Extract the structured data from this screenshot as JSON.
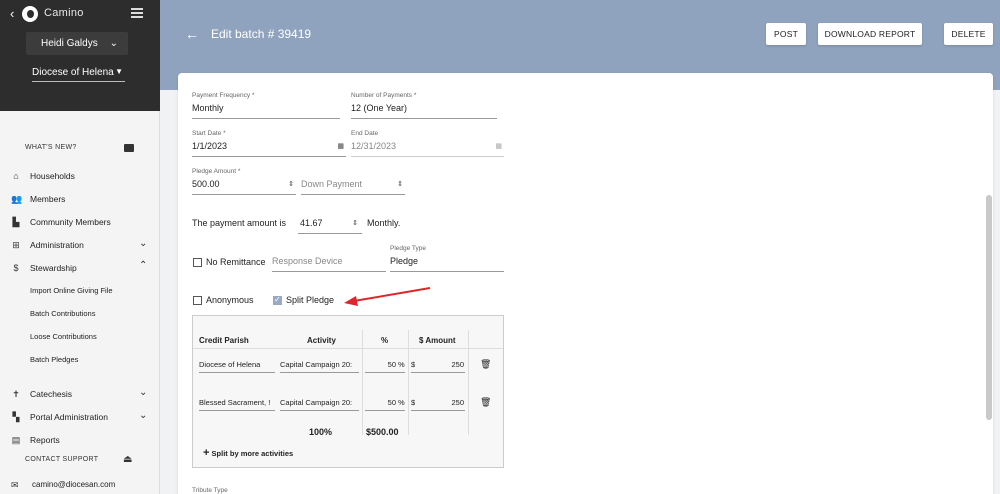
{
  "app": {
    "brand": "Camino",
    "user": "Heidi Galdys",
    "diocese": "Diocese of Helena"
  },
  "sidebar": {
    "whats_new": "WHAT'S NEW?",
    "items": [
      {
        "label": "Households",
        "icon": "home-icon"
      },
      {
        "label": "Members",
        "icon": "people-icon"
      },
      {
        "label": "Community Members",
        "icon": "community-icon"
      },
      {
        "label": "Administration",
        "icon": "grid-icon"
      },
      {
        "label": "Stewardship",
        "icon": "dollar-icon"
      },
      {
        "label": "Catechesis",
        "icon": "cross-icon"
      },
      {
        "label": "Portal Administration",
        "icon": "door-icon"
      },
      {
        "label": "Reports",
        "icon": "report-icon"
      }
    ],
    "stewardship_sub": [
      "Import Online Giving File",
      "Batch Contributions",
      "Loose Contributions",
      "Batch Pledges"
    ],
    "contact_support": "CONTACT SUPPORT",
    "email": "camino@diocesan.com"
  },
  "header": {
    "title": "Edit batch # 39419",
    "post": "POST",
    "download": "DOWNLOAD REPORT",
    "delete": "DELETE"
  },
  "form": {
    "payment_frequency": {
      "label": "Payment Frequency *",
      "value": "Monthly"
    },
    "number_of_payments": {
      "label": "Number of Payments *",
      "value": "12 (One Year)"
    },
    "start_date": {
      "label": "Start Date *",
      "value": "1/1/2023"
    },
    "end_date": {
      "label": "End Date",
      "value": "12/31/2023"
    },
    "pledge_amount": {
      "label": "Pledge Amount *",
      "value": "500.00"
    },
    "down_payment": {
      "placeholder": "Down Payment"
    },
    "payment_amount_prefix": "The payment amount is",
    "payment_amount": "41.67",
    "payment_amount_suffix": "Monthly.",
    "no_remittance": "No Remittance",
    "response_device": "Response Device",
    "pledge_type": {
      "label": "Pledge Type",
      "value": "Pledge"
    },
    "anonymous": "Anonymous",
    "split_pledge": "Split Pledge",
    "split_pledge_checked": true,
    "tribute_type": "Tribute Type"
  },
  "split_table": {
    "headers": {
      "parish": "Credit Parish",
      "activity": "Activity",
      "percent": "%",
      "amount": "$ Amount"
    },
    "rows": [
      {
        "parish": "Diocese of Helena",
        "activity": "Capital Campaign 20:",
        "percent": "50",
        "pct_sign": "%",
        "currency": "$",
        "amount": "250"
      },
      {
        "parish": "Blessed Sacrament, !",
        "activity": "Capital Campaign 20:",
        "percent": "50",
        "pct_sign": "%",
        "currency": "$",
        "amount": "250"
      }
    ],
    "total_percent": "100%",
    "total_amount": "$500.00",
    "add_label": "Split by more activities"
  },
  "colors": {
    "header_bg": "#8fa3be",
    "sidebar_top": "#2d2d2d",
    "annotation_arrow": "#e0262b"
  }
}
